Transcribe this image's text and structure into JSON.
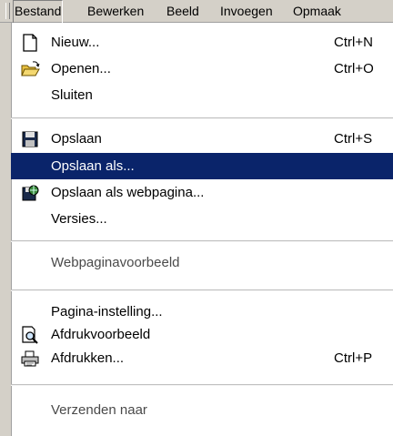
{
  "menubar": {
    "items": [
      "Bestand",
      "Bewerken",
      "Beeld",
      "Invoegen",
      "Opmaak"
    ]
  },
  "menu": {
    "items": [
      {
        "label": "Nieuw...",
        "shortcut": "Ctrl+N",
        "icon": "new-document-icon"
      },
      {
        "label": "Openen...",
        "shortcut": "Ctrl+O",
        "icon": "open-folder-icon"
      },
      {
        "label": "Sluiten",
        "shortcut": "",
        "icon": ""
      },
      {
        "label": "Opslaan",
        "shortcut": "Ctrl+S",
        "icon": "save-disk-icon"
      },
      {
        "label": "Opslaan als...",
        "shortcut": "",
        "icon": "",
        "highlighted": true
      },
      {
        "label": "Opslaan als webpagina...",
        "shortcut": "",
        "icon": "save-as-webpage-icon"
      },
      {
        "label": "Versies...",
        "shortcut": "",
        "icon": ""
      },
      {
        "label": "Webpaginavoorbeeld",
        "shortcut": "",
        "icon": ""
      },
      {
        "label": "Pagina-instelling...",
        "shortcut": "",
        "icon": ""
      },
      {
        "label": "Afdrukvoorbeeld",
        "shortcut": "",
        "icon": "print-preview-icon"
      },
      {
        "label": "Afdrukken...",
        "shortcut": "Ctrl+P",
        "icon": "printer-icon"
      },
      {
        "label": "Verzenden naar",
        "shortcut": "",
        "icon": ""
      }
    ]
  },
  "colors": {
    "menu_background": "#ffffff",
    "menubar_background": "#d4d0c8",
    "highlight_background": "#0a246a",
    "highlight_text": "#ffffff"
  }
}
